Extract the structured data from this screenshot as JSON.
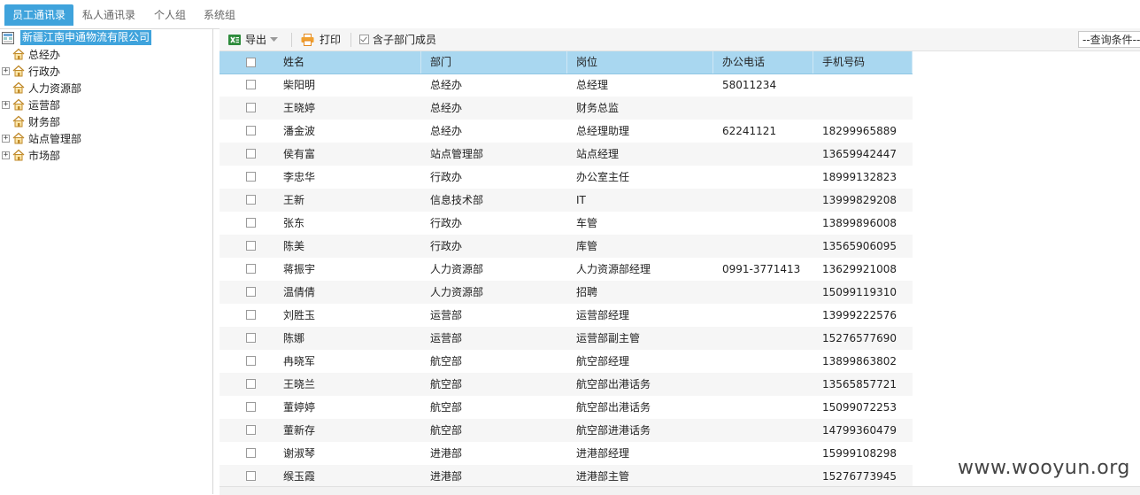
{
  "tabs": [
    {
      "label": "员工通讯录",
      "active": true
    },
    {
      "label": "私人通讯录",
      "active": false
    },
    {
      "label": "个人组",
      "active": false
    },
    {
      "label": "系统组",
      "active": false
    }
  ],
  "tree": {
    "root": "新疆江南申通物流有限公司",
    "nodes": [
      {
        "label": "总经办",
        "expandable": false
      },
      {
        "label": "行政办",
        "expandable": true
      },
      {
        "label": "人力资源部",
        "expandable": false
      },
      {
        "label": "运营部",
        "expandable": true
      },
      {
        "label": "财务部",
        "expandable": false
      },
      {
        "label": "站点管理部",
        "expandable": true
      },
      {
        "label": "市场部",
        "expandable": true
      }
    ]
  },
  "toolbar": {
    "export_label": "导出",
    "print_label": "打印",
    "include_sub_label": "含子部门成员",
    "include_sub_checked": true,
    "query_select": "--查询条件--"
  },
  "grid": {
    "columns": [
      "姓名",
      "部门",
      "岗位",
      "办公电话",
      "手机号码"
    ],
    "rows": [
      [
        "柴阳明",
        "总经办",
        "总经理",
        "58011234",
        ""
      ],
      [
        "王晓婷",
        "总经办",
        "财务总监",
        "",
        ""
      ],
      [
        "潘金波",
        "总经办",
        "总经理助理",
        "62241121",
        "18299965889"
      ],
      [
        "侯有富",
        "站点管理部",
        "站点经理",
        "",
        "13659942447"
      ],
      [
        "李忠华",
        "行政办",
        "办公室主任",
        "",
        "18999132823"
      ],
      [
        "王新",
        "信息技术部",
        "IT",
        "",
        "13999829208"
      ],
      [
        "张东",
        "行政办",
        "车管",
        "",
        "13899896008"
      ],
      [
        "陈美",
        "行政办",
        "库管",
        "",
        "13565906095"
      ],
      [
        "蒋振宇",
        "人力资源部",
        "人力资源部经理",
        "0991-3771413",
        "13629921008"
      ],
      [
        "温倩倩",
        "人力资源部",
        "招聘",
        "",
        "15099119310"
      ],
      [
        "刘胜玉",
        "运营部",
        "运营部经理",
        "",
        "13999222576"
      ],
      [
        "陈娜",
        "运营部",
        "运营部副主管",
        "",
        "15276577690"
      ],
      [
        "冉晓军",
        "航空部",
        "航空部经理",
        "",
        "13899863802"
      ],
      [
        "王晓兰",
        "航空部",
        "航空部出港话务",
        "",
        "13565857721"
      ],
      [
        "董婷婷",
        "航空部",
        "航空部出港话务",
        "",
        "15099072253"
      ],
      [
        "董新存",
        "航空部",
        "航空部进港话务",
        "",
        "14799360479"
      ],
      [
        "谢淑琴",
        "进港部",
        "进港部经理",
        "",
        "15999108298"
      ],
      [
        "缑玉霞",
        "进港部",
        "进港部主管",
        "",
        "15276773945"
      ]
    ]
  },
  "watermark": "www.wooyun.org",
  "colors": {
    "accent": "#3fa3dc",
    "header": "#a9d7f0"
  }
}
